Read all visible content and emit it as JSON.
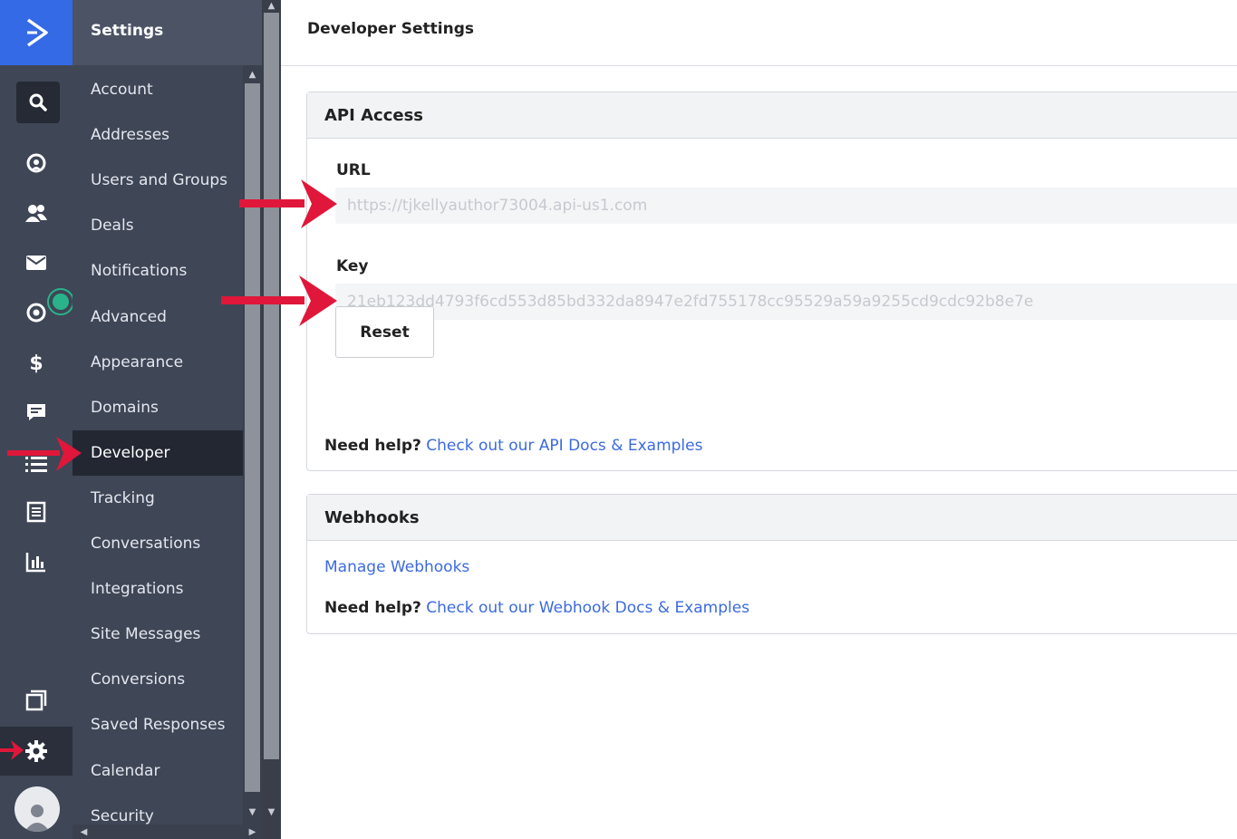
{
  "rail": {
    "icons": [
      "logo-chevron-icon",
      "search-icon",
      "contacts-icon",
      "users-icon",
      "email-icon",
      "automation-icon",
      "deals-icon",
      "conversations-icon",
      "lists-icon",
      "forms-icon",
      "reports-icon",
      "apps-icon",
      "gear-icon",
      "avatar-icon"
    ]
  },
  "menu": {
    "title": "Settings",
    "items": [
      {
        "label": "Account"
      },
      {
        "label": "Addresses"
      },
      {
        "label": "Users and Groups"
      },
      {
        "label": "Deals"
      },
      {
        "label": "Notifications"
      },
      {
        "label": "Advanced"
      },
      {
        "label": "Appearance"
      },
      {
        "label": "Domains"
      },
      {
        "label": "Developer",
        "active": true
      },
      {
        "label": "Tracking"
      },
      {
        "label": "Conversations"
      },
      {
        "label": "Integrations"
      },
      {
        "label": "Site Messages"
      },
      {
        "label": "Conversions"
      },
      {
        "label": "Saved Responses"
      },
      {
        "label": "Calendar"
      },
      {
        "label": "Security"
      }
    ]
  },
  "page": {
    "title": "Developer Settings"
  },
  "api_access": {
    "heading": "API Access",
    "url_label": "URL",
    "url_value": "https://tjkellyauthor73004.api-us1.com",
    "key_label": "Key",
    "key_value": "21eb123dd4793f6cd553d85bd332da8947e2fd755178cc95529a59a9255cd9cdc92b8e7e",
    "reset_label": "Reset",
    "help_prefix": "Need help?",
    "help_link": "Check out our API Docs & Examples"
  },
  "webhooks": {
    "heading": "Webhooks",
    "manage_link": "Manage Webhooks",
    "help_prefix": "Need help?",
    "help_link": "Check out our Webhook Docs & Examples"
  },
  "colors": {
    "brand": "#356ae6",
    "sidebar": "#3f4656",
    "active_item": "#232732",
    "link": "#3b6ae0",
    "annotation_arrow": "#e0173a",
    "status_dot": "#29b38a"
  }
}
